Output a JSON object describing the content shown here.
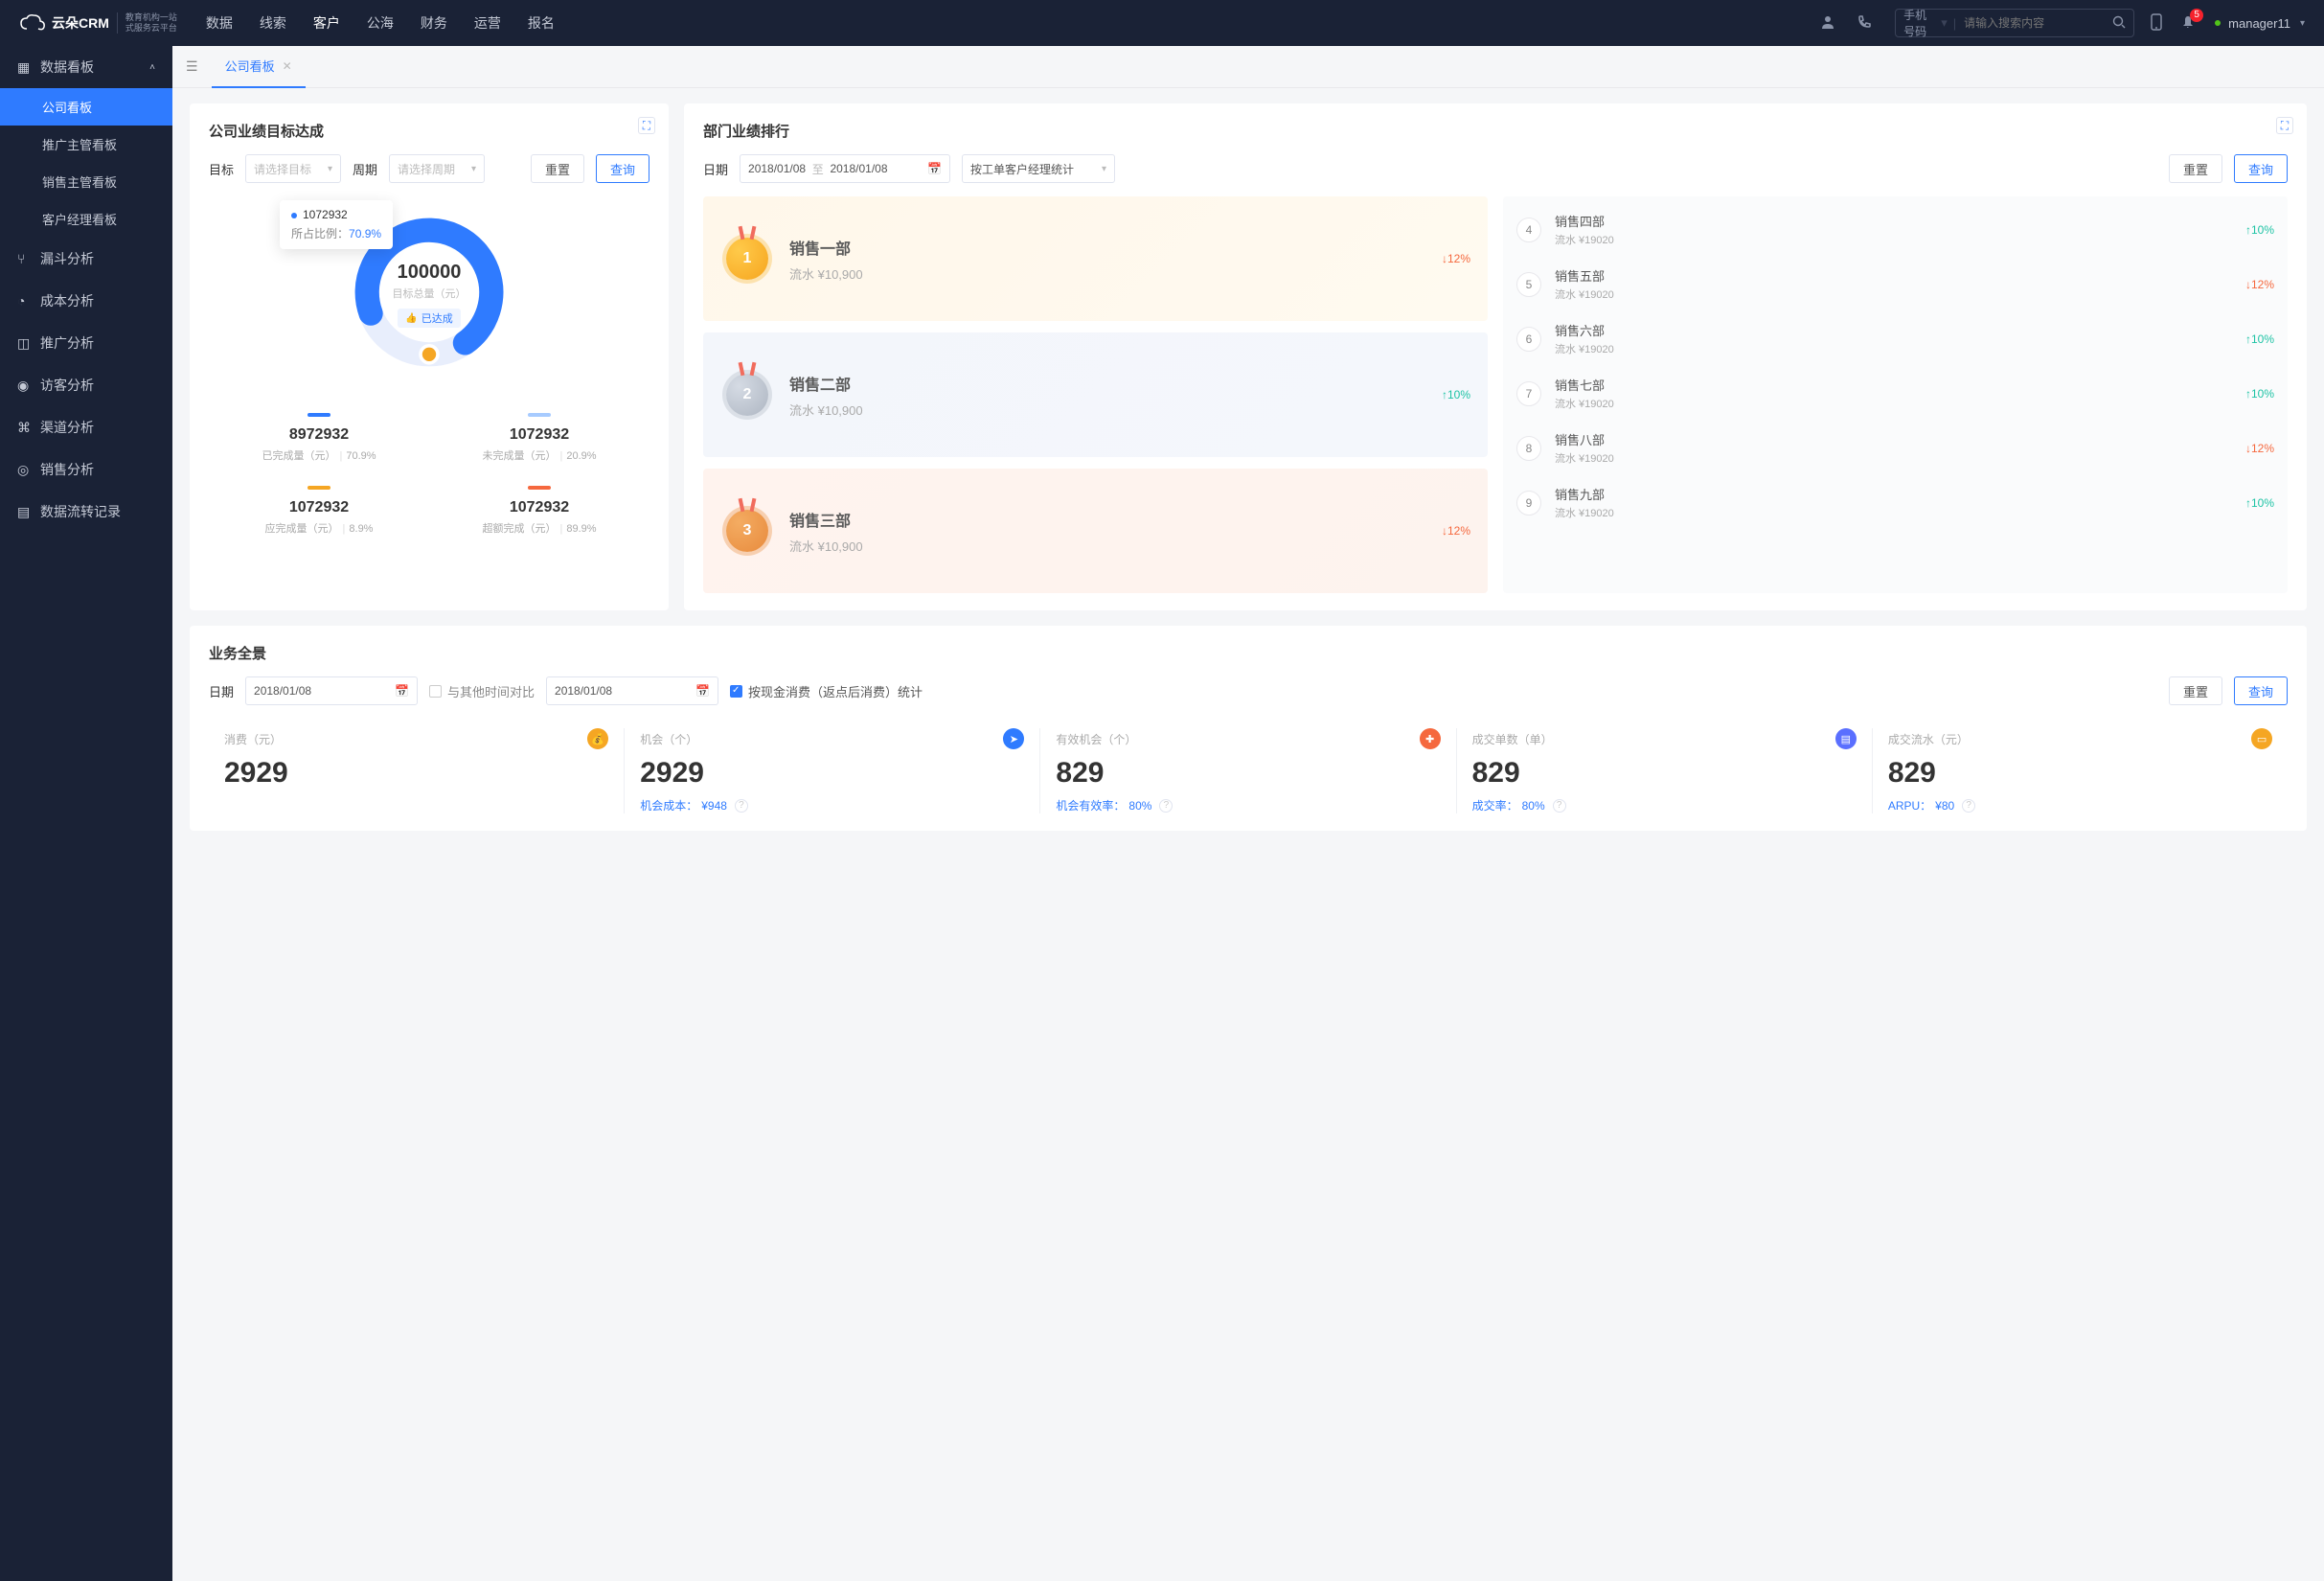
{
  "header": {
    "logo_text": "云朵CRM",
    "logo_sub1": "教育机构一站",
    "logo_sub2": "式服务云平台",
    "nav": [
      "数据",
      "线索",
      "客户",
      "公海",
      "财务",
      "运营",
      "报名"
    ],
    "active_nav": 2,
    "search_type": "手机号码",
    "search_placeholder": "请输入搜索内容",
    "notify_count": "5",
    "user_name": "manager11"
  },
  "sidebar": {
    "group_title": "数据看板",
    "children": [
      "公司看板",
      "推广主管看板",
      "销售主管看板",
      "客户经理看板"
    ],
    "active_child": 0,
    "items": [
      "漏斗分析",
      "成本分析",
      "推广分析",
      "访客分析",
      "渠道分析",
      "销售分析",
      "数据流转记录"
    ]
  },
  "tab": {
    "label": "公司看板"
  },
  "target_card": {
    "title": "公司业绩目标达成",
    "lbl_target": "目标",
    "sel_target_ph": "请选择目标",
    "lbl_period": "周期",
    "sel_period_ph": "请选择周期",
    "btn_reset": "重置",
    "btn_query": "查询",
    "tooltip_value": "1072932",
    "tooltip_label": "所占比例：",
    "tooltip_pct": "70.9%",
    "center_value": "100000",
    "center_sub": "目标总量（元）",
    "center_tag": "已达成",
    "stats": [
      {
        "bar": "#2f7bff",
        "value": "8972932",
        "label": "已完成量（元）",
        "pct": "70.9%"
      },
      {
        "bar": "#a7cbff",
        "value": "1072932",
        "label": "未完成量（元）",
        "pct": "20.9%"
      },
      {
        "bar": "#f5a623",
        "value": "1072932",
        "label": "应完成量（元）",
        "pct": "8.9%"
      },
      {
        "bar": "#f5683e",
        "value": "1072932",
        "label": "超额完成（元）",
        "pct": "89.9%"
      }
    ]
  },
  "rank_card": {
    "title": "部门业绩排行",
    "lbl_date": "日期",
    "date_from": "2018/01/08",
    "date_sep": "至",
    "date_to": "2018/01/08",
    "sel_type": "按工单客户经理统计",
    "btn_reset": "重置",
    "btn_query": "查询",
    "top": [
      {
        "rank": "1",
        "name": "销售一部",
        "sub": "流水 ¥10,900",
        "delta": "12%",
        "dir": "down"
      },
      {
        "rank": "2",
        "name": "销售二部",
        "sub": "流水 ¥10,900",
        "delta": "10%",
        "dir": "up"
      },
      {
        "rank": "3",
        "name": "销售三部",
        "sub": "流水 ¥10,900",
        "delta": "12%",
        "dir": "down"
      }
    ],
    "list": [
      {
        "rank": "4",
        "name": "销售四部",
        "sub": "流水 ¥19020",
        "delta": "10%",
        "dir": "up"
      },
      {
        "rank": "5",
        "name": "销售五部",
        "sub": "流水 ¥19020",
        "delta": "12%",
        "dir": "down"
      },
      {
        "rank": "6",
        "name": "销售六部",
        "sub": "流水 ¥19020",
        "delta": "10%",
        "dir": "up"
      },
      {
        "rank": "7",
        "name": "销售七部",
        "sub": "流水 ¥19020",
        "delta": "10%",
        "dir": "up"
      },
      {
        "rank": "8",
        "name": "销售八部",
        "sub": "流水 ¥19020",
        "delta": "12%",
        "dir": "down"
      },
      {
        "rank": "9",
        "name": "销售九部",
        "sub": "流水 ¥19020",
        "delta": "10%",
        "dir": "up"
      }
    ]
  },
  "overview": {
    "title": "业务全景",
    "lbl_date": "日期",
    "date1": "2018/01/08",
    "compare_lbl": "与其他时间对比",
    "date2": "2018/01/08",
    "check_lbl": "按现金消费（返点后消费）统计",
    "btn_reset": "重置",
    "btn_query": "查询",
    "metrics": [
      {
        "title": "消费（元）",
        "value": "2929",
        "ic": "#f5a623",
        "foot": "",
        "foot_val": ""
      },
      {
        "title": "机会（个）",
        "value": "2929",
        "ic": "#2f7bff",
        "foot": "机会成本：",
        "foot_val": "¥948"
      },
      {
        "title": "有效机会（个）",
        "value": "829",
        "ic": "#f5683e",
        "foot": "机会有效率：",
        "foot_val": "80%"
      },
      {
        "title": "成交单数（单）",
        "value": "829",
        "ic": "#5a6fff",
        "foot": "成交率：",
        "foot_val": "80%"
      },
      {
        "title": "成交流水（元）",
        "value": "829",
        "ic": "#f5a623",
        "foot": "ARPU：",
        "foot_val": "¥80"
      }
    ]
  },
  "chart_data": {
    "type": "pie",
    "title": "公司业绩目标达成",
    "total_label": "目标总量（元）",
    "total_value": 100000,
    "series": [
      {
        "name": "已完成量（元）",
        "value": 8972932,
        "pct": 70.9,
        "color": "#2f7bff"
      },
      {
        "name": "未完成量（元）",
        "value": 1072932,
        "pct": 20.9,
        "color": "#a7cbff"
      },
      {
        "name": "应完成量（元）",
        "value": 1072932,
        "pct": 8.9,
        "color": "#f5a623"
      },
      {
        "name": "超额完成（元）",
        "value": 1072932,
        "pct": 89.9,
        "color": "#f5683e"
      }
    ]
  }
}
